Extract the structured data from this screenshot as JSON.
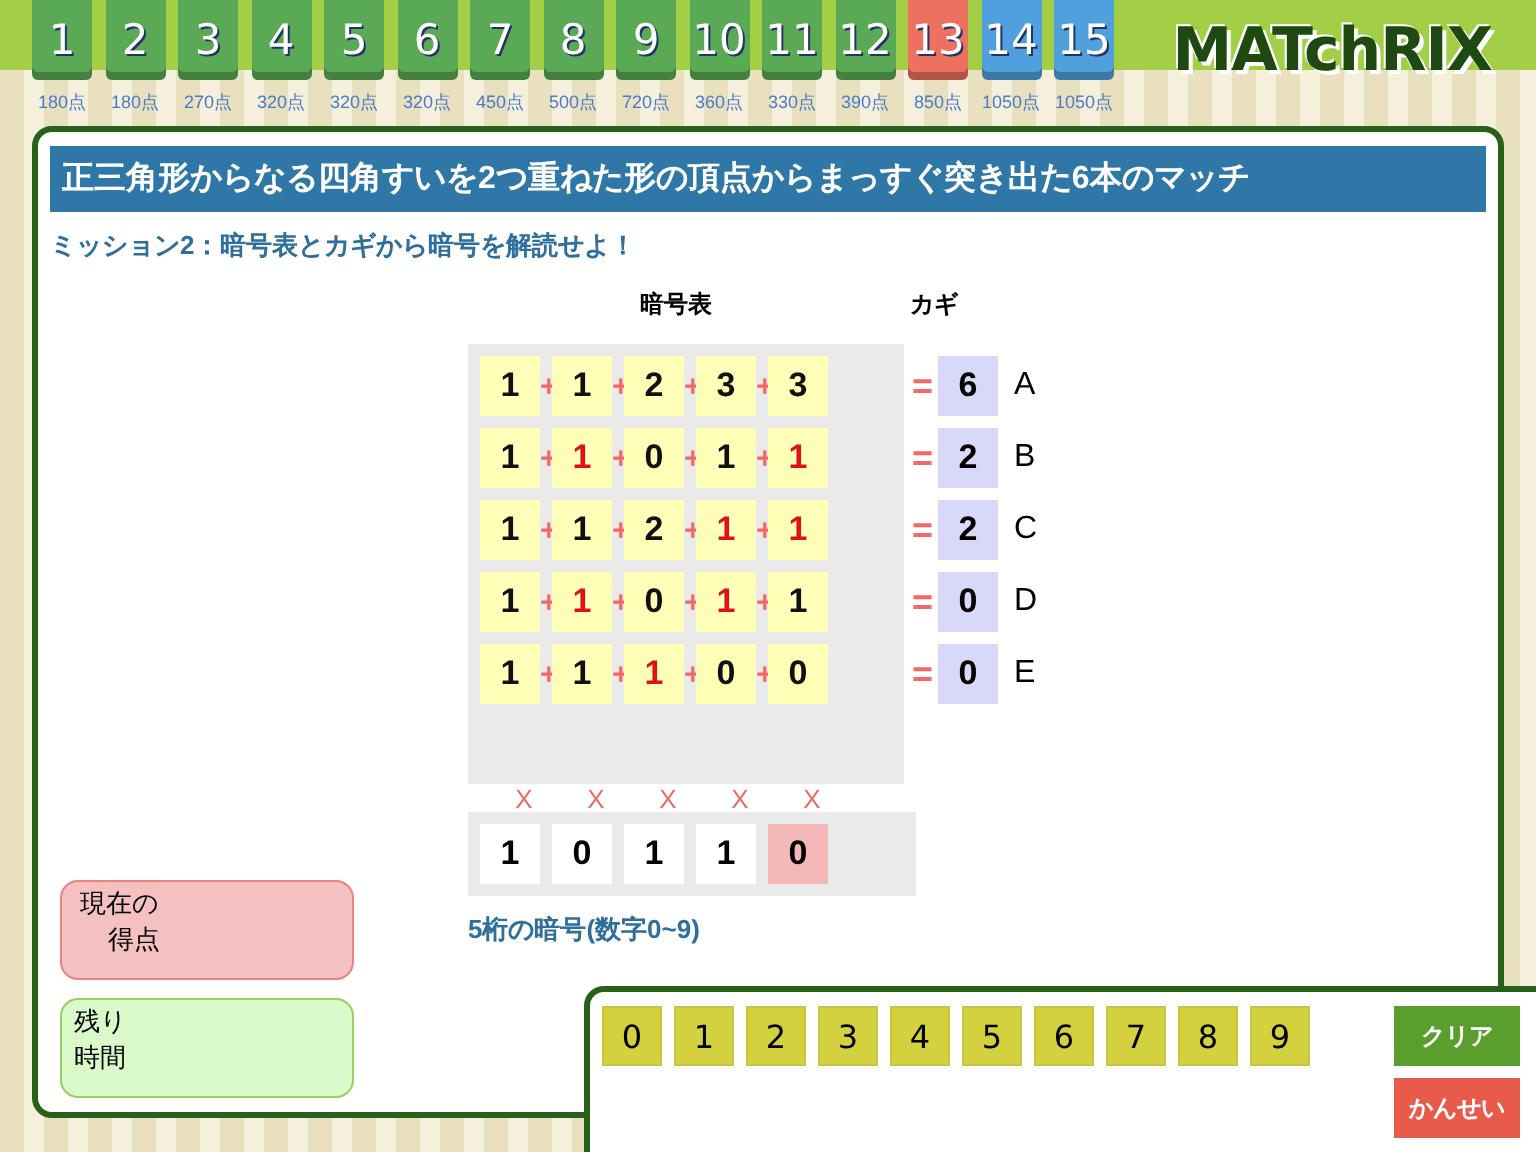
{
  "levels": [
    {
      "label": "1",
      "points": "180点",
      "color": "#5aaa55"
    },
    {
      "label": "2",
      "points": "180点",
      "color": "#5aaa55"
    },
    {
      "label": "3",
      "points": "270点",
      "color": "#5aaa55"
    },
    {
      "label": "4",
      "points": "320点",
      "color": "#5aaa55"
    },
    {
      "label": "5",
      "points": "320点",
      "color": "#5aaa55"
    },
    {
      "label": "6",
      "points": "320点",
      "color": "#5aaa55"
    },
    {
      "label": "7",
      "points": "450点",
      "color": "#5aaa55"
    },
    {
      "label": "8",
      "points": "500点",
      "color": "#5aaa55"
    },
    {
      "label": "9",
      "points": "720点",
      "color": "#5aaa55"
    },
    {
      "label": "10",
      "points": "360点",
      "color": "#5aaa55"
    },
    {
      "label": "11",
      "points": "330点",
      "color": "#5aaa55"
    },
    {
      "label": "12",
      "points": "390点",
      "color": "#5aaa55"
    },
    {
      "label": "13",
      "points": "850点",
      "color": "#ee7060"
    },
    {
      "label": "14",
      "points": "1050点",
      "color": "#4fa0dc"
    },
    {
      "label": "15",
      "points": "1050点",
      "color": "#4fa0dc"
    }
  ],
  "logo": "MATchRIX",
  "question": "正三角形からなる四角すいを2つ重ねた形の頂点からまっすぐ突き出た6本のマッチ",
  "mission": "ミッション2：暗号表とカギから暗号を解読せよ！",
  "table_header": "暗号表",
  "key_header": "カギ",
  "rows": [
    {
      "cells": [
        {
          "text": "1",
          "highlighted": false
        },
        {
          "text": "1",
          "highlighted": false
        },
        {
          "text": "2",
          "highlighted": false
        },
        {
          "text": "3",
          "highlighted": false
        },
        {
          "text": "3",
          "highlighted": false
        }
      ],
      "operators": [
        "+",
        "+",
        "+",
        "+"
      ],
      "equals": "=",
      "key": "6",
      "letter": "A"
    },
    {
      "cells": [
        {
          "text": "1",
          "highlighted": false
        },
        {
          "text": "1",
          "highlighted": true
        },
        {
          "text": "0",
          "highlighted": false
        },
        {
          "text": "1",
          "highlighted": false
        },
        {
          "text": "1",
          "highlighted": true
        }
      ],
      "operators": [
        "+",
        "+",
        "+",
        "+"
      ],
      "equals": "=",
      "key": "2",
      "letter": "B"
    },
    {
      "cells": [
        {
          "text": "1",
          "highlighted": false
        },
        {
          "text": "1",
          "highlighted": false
        },
        {
          "text": "2",
          "highlighted": false
        },
        {
          "text": "1",
          "highlighted": true
        },
        {
          "text": "1",
          "highlighted": true
        }
      ],
      "operators": [
        "+",
        "+",
        "+",
        "+"
      ],
      "equals": "=",
      "key": "2",
      "letter": "C"
    },
    {
      "cells": [
        {
          "text": "1",
          "highlighted": false
        },
        {
          "text": "1",
          "highlighted": true
        },
        {
          "text": "0",
          "highlighted": false
        },
        {
          "text": "1",
          "highlighted": true
        },
        {
          "text": "1",
          "highlighted": false
        }
      ],
      "operators": [
        "+",
        "+",
        "+",
        "+"
      ],
      "equals": "=",
      "key": "0",
      "letter": "D"
    },
    {
      "cells": [
        {
          "text": "1",
          "highlighted": false
        },
        {
          "text": "1",
          "highlighted": false
        },
        {
          "text": "1",
          "highlighted": true
        },
        {
          "text": "0",
          "highlighted": false
        },
        {
          "text": "0",
          "highlighted": false
        }
      ],
      "operators": [
        "+",
        "+",
        "+",
        "+"
      ],
      "equals": "=",
      "key": "0",
      "letter": "E"
    }
  ],
  "marks": [
    "X",
    "X",
    "X",
    "X",
    "X"
  ],
  "answer": [
    {
      "text": "1",
      "selected": false
    },
    {
      "text": "0",
      "selected": false
    },
    {
      "text": "1",
      "selected": false
    },
    {
      "text": "1",
      "selected": false
    },
    {
      "text": "0",
      "selected": true
    }
  ],
  "answer_hint": "5桁の暗号(数字0~9)",
  "score": {
    "lines": [
      "現在の",
      "得点"
    ]
  },
  "time": {
    "lines": [
      "残り",
      "時間"
    ]
  },
  "keypad": {
    "keys": [
      "0",
      "1",
      "2",
      "3",
      "4",
      "5",
      "6",
      "7",
      "8",
      "9"
    ],
    "buttons": [
      {
        "label": "クリア",
        "kind": "clear"
      },
      {
        "label": "かんせい",
        "kind": "submit"
      }
    ]
  }
}
